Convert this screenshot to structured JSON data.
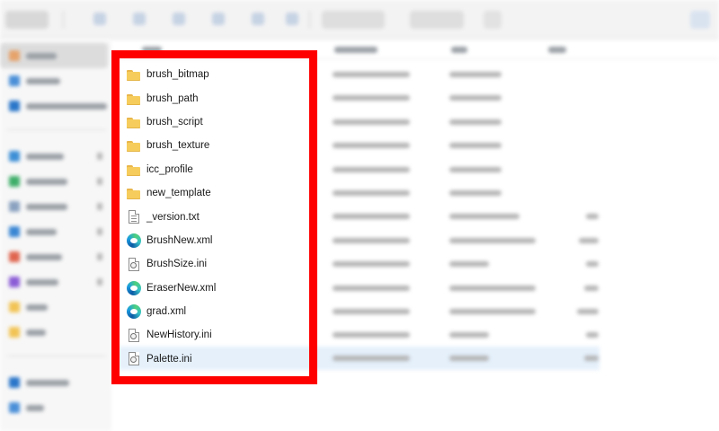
{
  "files": [
    {
      "name": "brush_bitmap",
      "type": "folder",
      "icon": "folder-icon"
    },
    {
      "name": "brush_path",
      "type": "folder",
      "icon": "folder-icon"
    },
    {
      "name": "brush_script",
      "type": "folder",
      "icon": "folder-icon"
    },
    {
      "name": "brush_texture",
      "type": "folder",
      "icon": "folder-icon"
    },
    {
      "name": "icc_profile",
      "type": "folder",
      "icon": "folder-icon"
    },
    {
      "name": "new_template",
      "type": "folder",
      "icon": "folder-icon"
    },
    {
      "name": "_version.txt",
      "type": "text",
      "icon": "text-file-icon"
    },
    {
      "name": "BrushNew.xml",
      "type": "xml",
      "icon": "edge-icon"
    },
    {
      "name": "BrushSize.ini",
      "type": "ini",
      "icon": "ini-file-icon"
    },
    {
      "name": "EraserNew.xml",
      "type": "xml",
      "icon": "edge-icon"
    },
    {
      "name": "grad.xml",
      "type": "xml",
      "icon": "edge-icon"
    },
    {
      "name": "NewHistory.ini",
      "type": "ini",
      "icon": "ini-file-icon"
    },
    {
      "name": "Palette.ini",
      "type": "ini",
      "icon": "ini-file-icon",
      "selected": true
    }
  ],
  "colors": {
    "highlight_frame": "#ff0000",
    "selected_row": "#e5f0fb",
    "folder": "#f6cd5c"
  }
}
